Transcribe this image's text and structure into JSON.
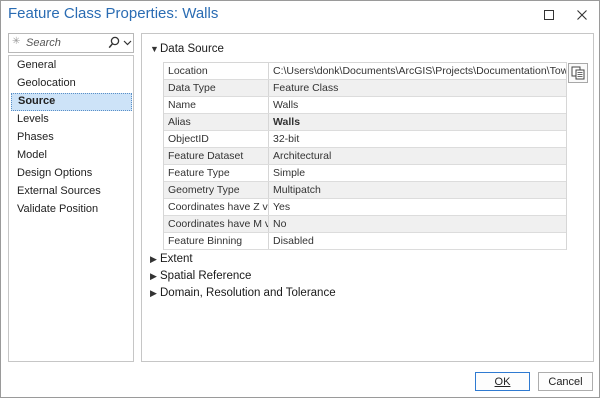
{
  "window": {
    "title": "Feature Class Properties: Walls",
    "maximize_icon": "maximize-icon",
    "close_icon": "close-icon"
  },
  "search": {
    "placeholder": "Search",
    "icon": "search-icon"
  },
  "nav": {
    "items": [
      {
        "label": "General"
      },
      {
        "label": "Geolocation"
      },
      {
        "label": "Source",
        "selected": true
      },
      {
        "label": "Levels"
      },
      {
        "label": "Phases"
      },
      {
        "label": "Model"
      },
      {
        "label": "Design Options"
      },
      {
        "label": "External Sources"
      },
      {
        "label": "Validate Position"
      }
    ]
  },
  "main": {
    "data_source": {
      "heading": "Data Source",
      "expanded": true,
      "rows": [
        {
          "key": "Location",
          "value": "C:\\Users\\donk\\Documents\\ArcGIS\\Projects\\Documentation\\Towers Sample A"
        },
        {
          "key": "Data Type",
          "value": "Feature Class"
        },
        {
          "key": "Name",
          "value": "Walls"
        },
        {
          "key": "Alias",
          "value": "Walls"
        },
        {
          "key": "ObjectID",
          "value": "32-bit"
        },
        {
          "key": "Feature Dataset",
          "value": "Architectural"
        },
        {
          "key": "Feature Type",
          "value": "Simple"
        },
        {
          "key": "Geometry Type",
          "value": "Multipatch"
        },
        {
          "key": "Coordinates have Z value",
          "value": "Yes"
        },
        {
          "key": "Coordinates have M value",
          "value": "No"
        },
        {
          "key": "Feature Binning",
          "value": "Disabled"
        }
      ]
    },
    "collapsed_sections": [
      {
        "heading": "Extent"
      },
      {
        "heading": "Spatial Reference"
      },
      {
        "heading": "Domain, Resolution and Tolerance"
      }
    ]
  },
  "footer": {
    "ok_label": "OK",
    "cancel_label": "Cancel"
  },
  "colors": {
    "title": "#2a6cb3",
    "selection": "#cde3f8",
    "ok_border": "#2f7ad1"
  }
}
